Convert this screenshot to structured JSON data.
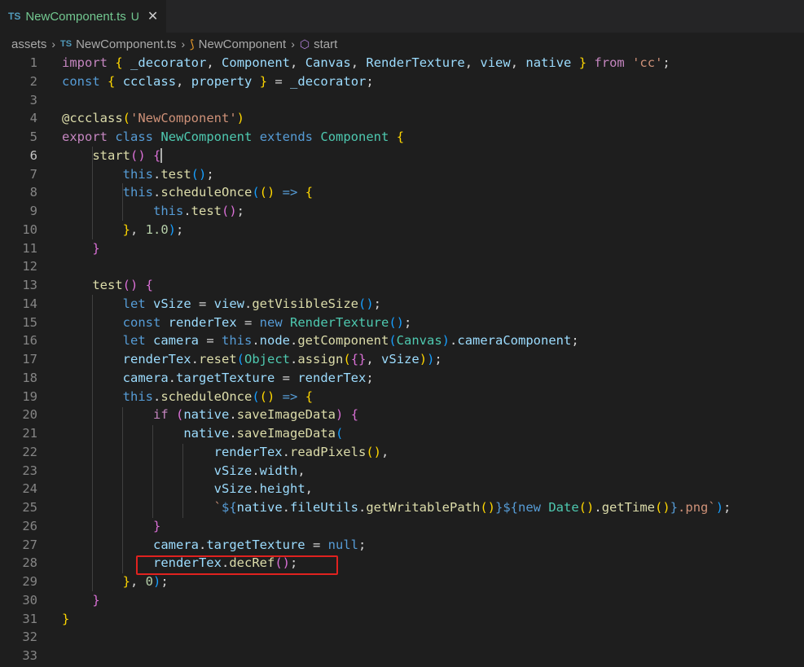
{
  "tab": {
    "lang": "TS",
    "filename": "NewComponent.ts",
    "status": "U"
  },
  "breadcrumb": {
    "folder": "assets",
    "file_lang": "TS",
    "file": "NewComponent.ts",
    "class": "NewComponent",
    "method": "start"
  },
  "icons": {
    "close": "close-icon",
    "class": "class-icon",
    "method": "method-icon",
    "chevron": "chevron-right-icon"
  },
  "colors": {
    "highlight_box": "#e0221f",
    "tab_name": "#73c991",
    "background": "#1e1e1e"
  },
  "editor": {
    "active_line": 6,
    "highlighted_line": 28,
    "line_numbers": [
      "1",
      "2",
      "3",
      "4",
      "5",
      "6",
      "7",
      "8",
      "9",
      "10",
      "11",
      "12",
      "13",
      "14",
      "15",
      "16",
      "17",
      "18",
      "19",
      "20",
      "21",
      "22",
      "23",
      "24",
      "25",
      "26",
      "27",
      "28",
      "29",
      "30",
      "31",
      "32",
      "33"
    ],
    "lines": [
      [
        [
          "c",
          "import"
        ],
        [
          "p",
          " "
        ],
        [
          "b1",
          "{"
        ],
        [
          "p",
          " "
        ],
        [
          "v",
          "_decorator"
        ],
        [
          "p",
          ", "
        ],
        [
          "v",
          "Component"
        ],
        [
          "p",
          ", "
        ],
        [
          "v",
          "Canvas"
        ],
        [
          "p",
          ", "
        ],
        [
          "v",
          "RenderTexture"
        ],
        [
          "p",
          ", "
        ],
        [
          "v",
          "view"
        ],
        [
          "p",
          ", "
        ],
        [
          "v",
          "native"
        ],
        [
          "p",
          " "
        ],
        [
          "b1",
          "}"
        ],
        [
          "p",
          " "
        ],
        [
          "c",
          "from"
        ],
        [
          "p",
          " "
        ],
        [
          "s",
          "'cc'"
        ],
        [
          "p",
          ";"
        ]
      ],
      [
        [
          "k",
          "const"
        ],
        [
          "p",
          " "
        ],
        [
          "b1",
          "{"
        ],
        [
          "p",
          " "
        ],
        [
          "v",
          "ccclass"
        ],
        [
          "p",
          ", "
        ],
        [
          "v",
          "property"
        ],
        [
          "p",
          " "
        ],
        [
          "b1",
          "}"
        ],
        [
          "p",
          " = "
        ],
        [
          "v",
          "_decorator"
        ],
        [
          "p",
          ";"
        ]
      ],
      [],
      [
        [
          "f",
          "@ccclass"
        ],
        [
          "b1",
          "("
        ],
        [
          "s",
          "'NewComponent'"
        ],
        [
          "b1",
          ")"
        ]
      ],
      [
        [
          "c",
          "export"
        ],
        [
          "p",
          " "
        ],
        [
          "k",
          "class"
        ],
        [
          "p",
          " "
        ],
        [
          "t",
          "NewComponent"
        ],
        [
          "p",
          " "
        ],
        [
          "k",
          "extends"
        ],
        [
          "p",
          " "
        ],
        [
          "t",
          "Component"
        ],
        [
          "p",
          " "
        ],
        [
          "b1",
          "{"
        ]
      ],
      [
        [
          "p",
          "    "
        ],
        [
          "f",
          "start"
        ],
        [
          "b2",
          "()"
        ],
        [
          "p",
          " "
        ],
        [
          "b2",
          "{"
        ],
        [
          "cursor",
          ""
        ]
      ],
      [
        [
          "p",
          "        "
        ],
        [
          "k",
          "this"
        ],
        [
          "p",
          "."
        ],
        [
          "f",
          "test"
        ],
        [
          "b3",
          "()"
        ],
        [
          "p",
          ";"
        ]
      ],
      [
        [
          "p",
          "        "
        ],
        [
          "k",
          "this"
        ],
        [
          "p",
          "."
        ],
        [
          "f",
          "scheduleOnce"
        ],
        [
          "b3",
          "("
        ],
        [
          "b1",
          "()"
        ],
        [
          "p",
          " "
        ],
        [
          "k",
          "=>"
        ],
        [
          "p",
          " "
        ],
        [
          "b1",
          "{"
        ]
      ],
      [
        [
          "p",
          "            "
        ],
        [
          "k",
          "this"
        ],
        [
          "p",
          "."
        ],
        [
          "f",
          "test"
        ],
        [
          "b2",
          "()"
        ],
        [
          "p",
          ";"
        ]
      ],
      [
        [
          "p",
          "        "
        ],
        [
          "b1",
          "}"
        ],
        [
          "p",
          ", "
        ],
        [
          "n",
          "1.0"
        ],
        [
          "b3",
          ")"
        ],
        [
          "p",
          ";"
        ]
      ],
      [
        [
          "p",
          "    "
        ],
        [
          "b2",
          "}"
        ]
      ],
      [],
      [
        [
          "p",
          "    "
        ],
        [
          "f",
          "test"
        ],
        [
          "b2",
          "()"
        ],
        [
          "p",
          " "
        ],
        [
          "b2",
          "{"
        ]
      ],
      [
        [
          "p",
          "        "
        ],
        [
          "k",
          "let"
        ],
        [
          "p",
          " "
        ],
        [
          "v",
          "vSize"
        ],
        [
          "p",
          " = "
        ],
        [
          "v",
          "view"
        ],
        [
          "p",
          "."
        ],
        [
          "f",
          "getVisibleSize"
        ],
        [
          "b3",
          "()"
        ],
        [
          "p",
          ";"
        ]
      ],
      [
        [
          "p",
          "        "
        ],
        [
          "k",
          "const"
        ],
        [
          "p",
          " "
        ],
        [
          "v",
          "renderTex"
        ],
        [
          "p",
          " = "
        ],
        [
          "k",
          "new"
        ],
        [
          "p",
          " "
        ],
        [
          "t",
          "RenderTexture"
        ],
        [
          "b3",
          "()"
        ],
        [
          "p",
          ";"
        ]
      ],
      [
        [
          "p",
          "        "
        ],
        [
          "k",
          "let"
        ],
        [
          "p",
          " "
        ],
        [
          "v",
          "camera"
        ],
        [
          "p",
          " = "
        ],
        [
          "k",
          "this"
        ],
        [
          "p",
          "."
        ],
        [
          "v",
          "node"
        ],
        [
          "p",
          "."
        ],
        [
          "f",
          "getComponent"
        ],
        [
          "b3",
          "("
        ],
        [
          "t",
          "Canvas"
        ],
        [
          "b3",
          ")"
        ],
        [
          "p",
          "."
        ],
        [
          "v",
          "cameraComponent"
        ],
        [
          "p",
          ";"
        ]
      ],
      [
        [
          "p",
          "        "
        ],
        [
          "v",
          "renderTex"
        ],
        [
          "p",
          "."
        ],
        [
          "f",
          "reset"
        ],
        [
          "b3",
          "("
        ],
        [
          "t",
          "Object"
        ],
        [
          "p",
          "."
        ],
        [
          "f",
          "assign"
        ],
        [
          "b1",
          "("
        ],
        [
          "b2",
          "{}"
        ],
        [
          "p",
          ", "
        ],
        [
          "v",
          "vSize"
        ],
        [
          "b1",
          ")"
        ],
        [
          "b3",
          ")"
        ],
        [
          "p",
          ";"
        ]
      ],
      [
        [
          "p",
          "        "
        ],
        [
          "v",
          "camera"
        ],
        [
          "p",
          "."
        ],
        [
          "v",
          "targetTexture"
        ],
        [
          "p",
          " = "
        ],
        [
          "v",
          "renderTex"
        ],
        [
          "p",
          ";"
        ]
      ],
      [
        [
          "p",
          "        "
        ],
        [
          "k",
          "this"
        ],
        [
          "p",
          "."
        ],
        [
          "f",
          "scheduleOnce"
        ],
        [
          "b3",
          "("
        ],
        [
          "b1",
          "()"
        ],
        [
          "p",
          " "
        ],
        [
          "k",
          "=>"
        ],
        [
          "p",
          " "
        ],
        [
          "b1",
          "{"
        ]
      ],
      [
        [
          "p",
          "            "
        ],
        [
          "c",
          "if"
        ],
        [
          "p",
          " "
        ],
        [
          "b2",
          "("
        ],
        [
          "v",
          "native"
        ],
        [
          "p",
          "."
        ],
        [
          "f",
          "saveImageData"
        ],
        [
          "b2",
          ")"
        ],
        [
          "p",
          " "
        ],
        [
          "b2",
          "{"
        ]
      ],
      [
        [
          "p",
          "                "
        ],
        [
          "v",
          "native"
        ],
        [
          "p",
          "."
        ],
        [
          "f",
          "saveImageData"
        ],
        [
          "b3",
          "("
        ]
      ],
      [
        [
          "p",
          "                    "
        ],
        [
          "v",
          "renderTex"
        ],
        [
          "p",
          "."
        ],
        [
          "f",
          "readPixels"
        ],
        [
          "b1",
          "()"
        ],
        [
          "p",
          ","
        ]
      ],
      [
        [
          "p",
          "                    "
        ],
        [
          "v",
          "vSize"
        ],
        [
          "p",
          "."
        ],
        [
          "v",
          "width"
        ],
        [
          "p",
          ","
        ]
      ],
      [
        [
          "p",
          "                    "
        ],
        [
          "v",
          "vSize"
        ],
        [
          "p",
          "."
        ],
        [
          "v",
          "height"
        ],
        [
          "p",
          ","
        ]
      ],
      [
        [
          "p",
          "                    "
        ],
        [
          "s",
          "`"
        ],
        [
          "k",
          "${"
        ],
        [
          "v",
          "native"
        ],
        [
          "p",
          "."
        ],
        [
          "v",
          "fileUtils"
        ],
        [
          "p",
          "."
        ],
        [
          "f",
          "getWritablePath"
        ],
        [
          "b1",
          "()"
        ],
        [
          "k",
          "}${"
        ],
        [
          "k",
          "new"
        ],
        [
          "p",
          " "
        ],
        [
          "t",
          "Date"
        ],
        [
          "b1",
          "()"
        ],
        [
          "p",
          "."
        ],
        [
          "f",
          "getTime"
        ],
        [
          "b1",
          "()"
        ],
        [
          "k",
          "}"
        ],
        [
          "s",
          ".png`"
        ],
        [
          "b3",
          ")"
        ],
        [
          "p",
          ";"
        ]
      ],
      [
        [
          "p",
          "            "
        ],
        [
          "b2",
          "}"
        ]
      ],
      [
        [
          "p",
          "            "
        ],
        [
          "v",
          "camera"
        ],
        [
          "p",
          "."
        ],
        [
          "v",
          "targetTexture"
        ],
        [
          "p",
          " = "
        ],
        [
          "k",
          "null"
        ],
        [
          "p",
          ";"
        ]
      ],
      [
        [
          "p",
          "            "
        ],
        [
          "v",
          "renderTex"
        ],
        [
          "p",
          "."
        ],
        [
          "f",
          "decRef"
        ],
        [
          "b2",
          "()"
        ],
        [
          "p",
          ";"
        ]
      ],
      [
        [
          "p",
          "        "
        ],
        [
          "b1",
          "}"
        ],
        [
          "p",
          ", "
        ],
        [
          "n",
          "0"
        ],
        [
          "b3",
          ")"
        ],
        [
          "p",
          ";"
        ]
      ],
      [
        [
          "p",
          "    "
        ],
        [
          "b2",
          "}"
        ]
      ],
      [
        [
          "b1",
          "}"
        ]
      ],
      [],
      []
    ]
  }
}
